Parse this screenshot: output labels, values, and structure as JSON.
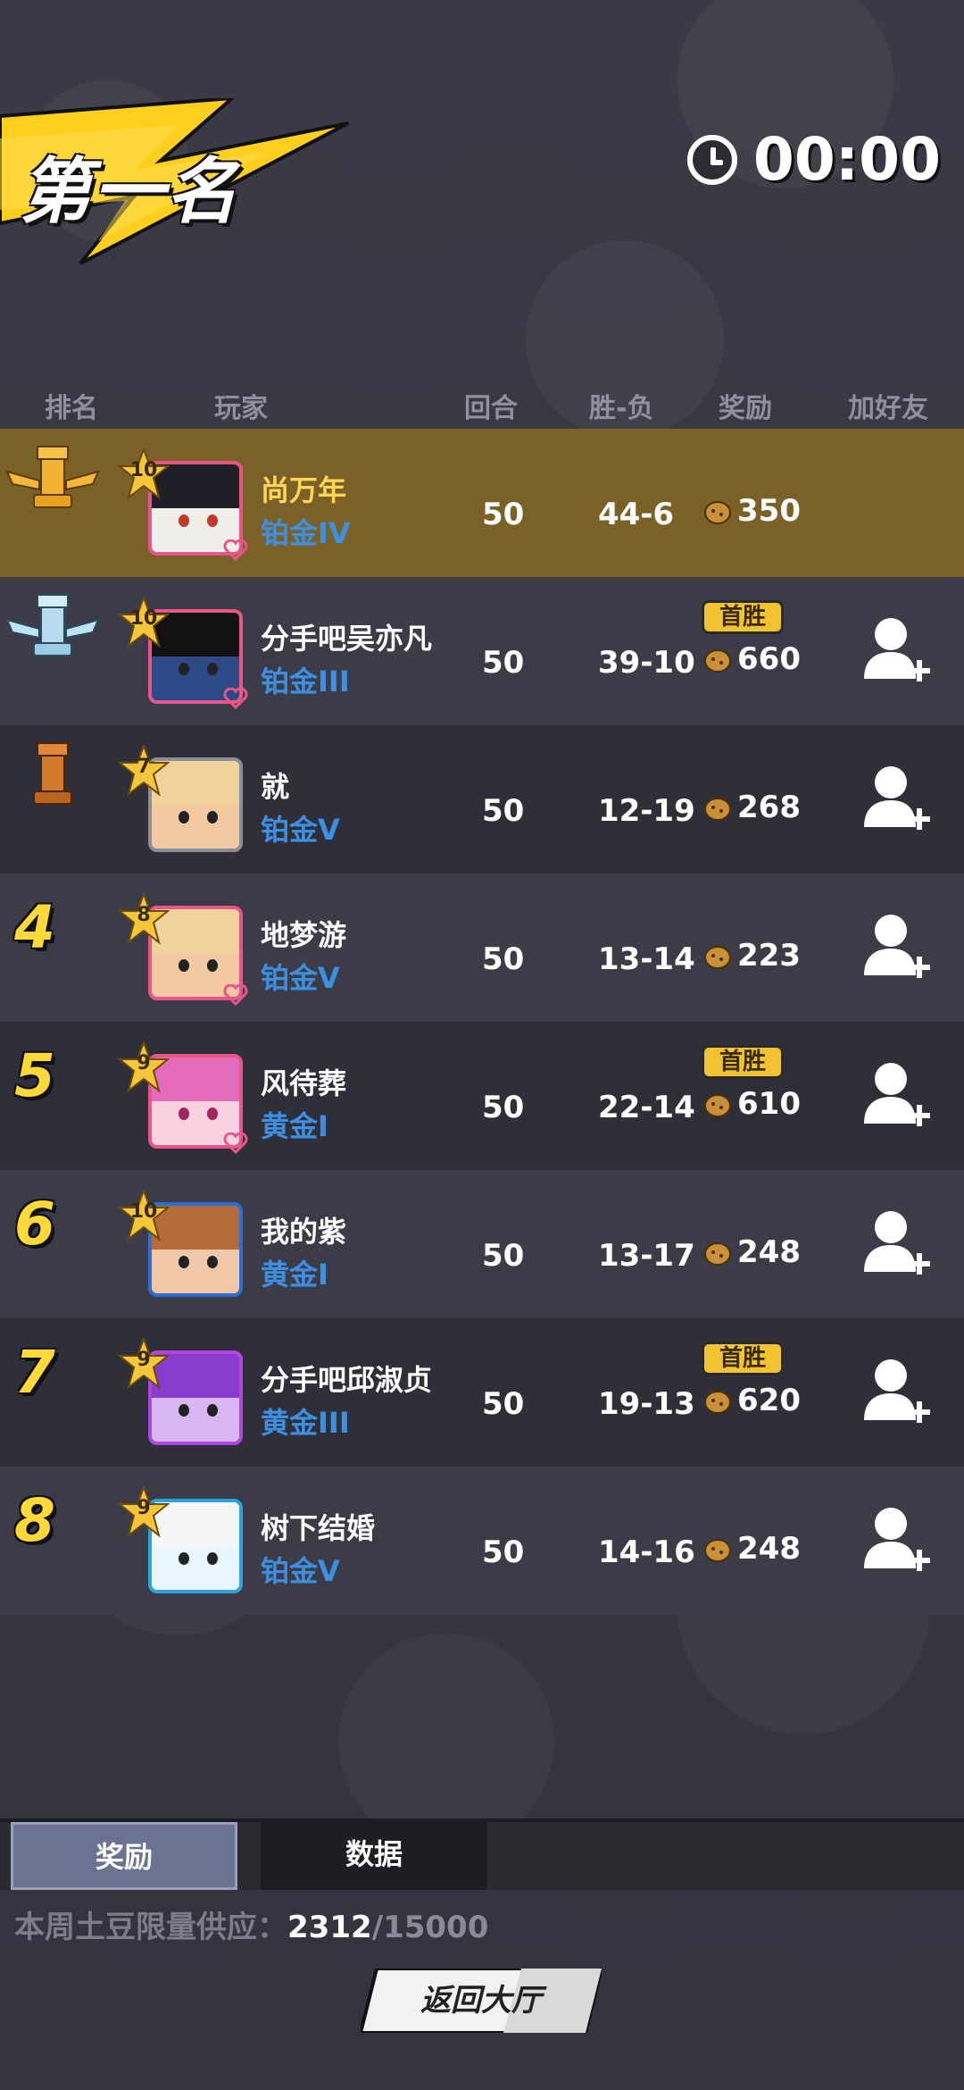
{
  "header": {
    "title": "第一名",
    "timer": "00:00"
  },
  "columns": {
    "rank": "排名",
    "player": "玩家",
    "rounds": "回合",
    "win_loss": "胜-负",
    "reward": "奖励",
    "add_friend": "加好友"
  },
  "players": [
    {
      "rank": "1",
      "name": "尚万年",
      "tier": "铂金IV",
      "level": "10",
      "rounds": "50",
      "win_loss": "44-6",
      "reward": "350",
      "first_win": "",
      "is_self": true,
      "trophy": "gold"
    },
    {
      "rank": "2",
      "name": "分手吧吴亦凡",
      "tier": "铂金III",
      "level": "10",
      "rounds": "50",
      "win_loss": "39-10",
      "reward": "660",
      "first_win": "首胜",
      "is_self": false,
      "trophy": "silver"
    },
    {
      "rank": "3",
      "name": "就",
      "tier": "铂金V",
      "level": "7",
      "rounds": "50",
      "win_loss": "12-19",
      "reward": "268",
      "first_win": "",
      "is_self": false,
      "trophy": "bronze"
    },
    {
      "rank": "4",
      "name": "地梦游",
      "tier": "铂金V",
      "level": "8",
      "rounds": "50",
      "win_loss": "13-14",
      "reward": "223",
      "first_win": "",
      "is_self": false,
      "trophy": ""
    },
    {
      "rank": "5",
      "name": "风待葬",
      "tier": "黄金I",
      "level": "9",
      "rounds": "50",
      "win_loss": "22-14",
      "reward": "610",
      "first_win": "首胜",
      "is_self": false,
      "trophy": ""
    },
    {
      "rank": "6",
      "name": "我的紫",
      "tier": "黄金I",
      "level": "10",
      "rounds": "50",
      "win_loss": "13-17",
      "reward": "248",
      "first_win": "",
      "is_self": false,
      "trophy": ""
    },
    {
      "rank": "7",
      "name": "分手吧邱淑贞",
      "tier": "黄金III",
      "level": "9",
      "rounds": "50",
      "win_loss": "19-13",
      "reward": "620",
      "first_win": "首胜",
      "is_self": false,
      "trophy": ""
    },
    {
      "rank": "8",
      "name": "树下结婚",
      "tier": "铂金V",
      "level": "9",
      "rounds": "50",
      "win_loss": "14-16",
      "reward": "248",
      "first_win": "",
      "is_self": false,
      "trophy": ""
    }
  ],
  "tabs": {
    "reward": "奖励",
    "data": "数据"
  },
  "supply": {
    "label": "本周土豆限量供应：",
    "current": "2312",
    "separator": "/",
    "max": "15000"
  },
  "return_button": "返回大厅",
  "colors": {
    "self_row": "#7a6128",
    "tier_blue": "#3e8fe0",
    "rank_yellow": "#ffd93a",
    "first_win_badge": "#f1c232"
  }
}
